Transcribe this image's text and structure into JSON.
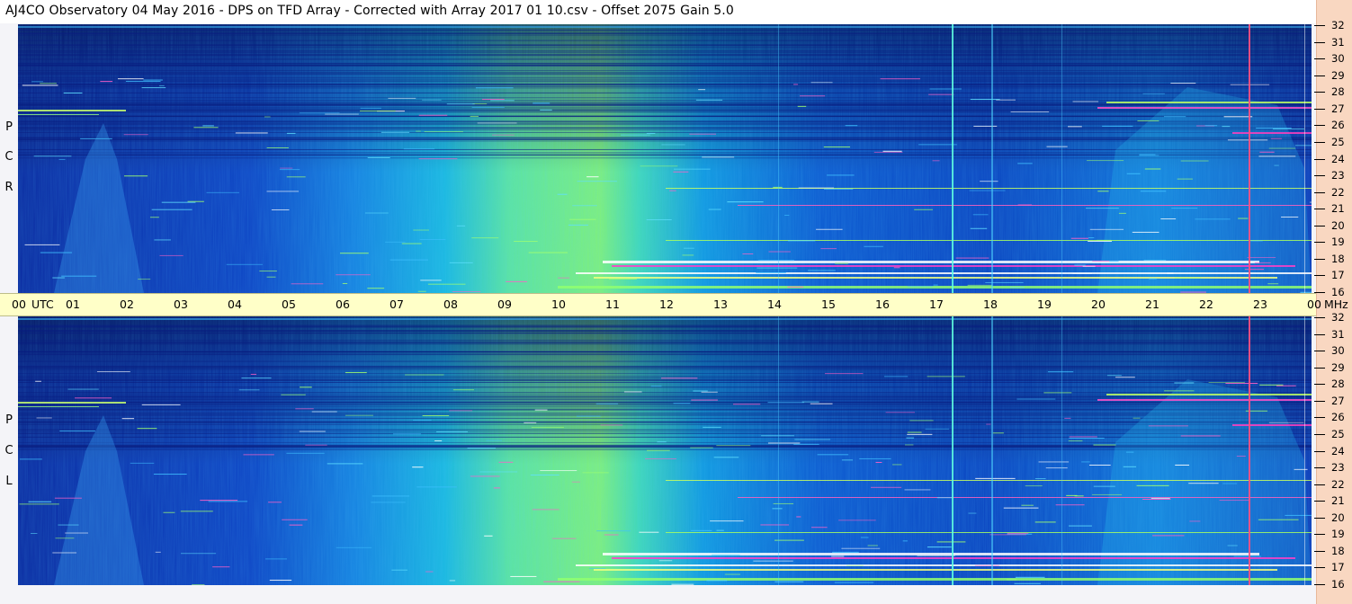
{
  "title": "AJ4CO Observatory  04 May 2016  -  DPS on TFD Array  -  Corrected with Array 2017 01 10.csv  -  Offset 2075  Gain 5.0",
  "polarizations": [
    {
      "id": "rcp",
      "letters": [
        "P",
        "C",
        "R"
      ]
    },
    {
      "id": "lcp",
      "letters": [
        "P",
        "C",
        "L"
      ]
    }
  ],
  "time_axis": {
    "labels": [
      "00",
      "UTC",
      "01",
      "02",
      "03",
      "04",
      "05",
      "06",
      "07",
      "08",
      "09",
      "10",
      "11",
      "12",
      "13",
      "14",
      "15",
      "16",
      "17",
      "18",
      "19",
      "20",
      "21",
      "22",
      "23",
      "00",
      "MHz"
    ]
  },
  "colors": {
    "background_low": "#0a2aa0",
    "mid": "#1ab8e0",
    "high": "#7ff07a",
    "hot": "#ff30c0",
    "time_axis_bg": "#ffffc8",
    "freq_axis_bg": "#f9d7c1"
  },
  "chart_data": {
    "type": "heatmap",
    "title": "AJ4CO Observatory  04 May 2016  -  DPS on TFD Array  -  Corrected with Array 2017 01 10.csv  -  Offset 2075  Gain 5.0",
    "x": {
      "unit": "UTC hour",
      "range": [
        0,
        24
      ],
      "ticks": [
        0,
        1,
        2,
        3,
        4,
        5,
        6,
        7,
        8,
        9,
        10,
        11,
        12,
        13,
        14,
        15,
        16,
        17,
        18,
        19,
        20,
        21,
        22,
        23,
        24
      ]
    },
    "y": {
      "unit": "MHz",
      "range": [
        16,
        32
      ],
      "tick_labels": [
        "32",
        "31",
        "30",
        "29",
        "28",
        "27",
        "26",
        "25",
        "24",
        "23",
        "22",
        "21",
        "20",
        "19",
        "18",
        "17",
        "16"
      ]
    },
    "panels": [
      "RCP",
      "LCP"
    ]
  }
}
